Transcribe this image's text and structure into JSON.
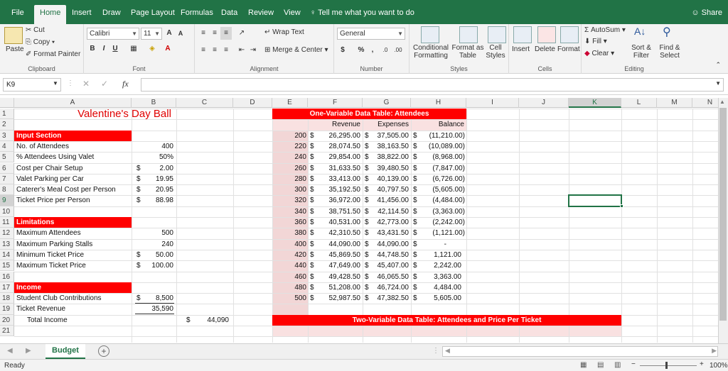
{
  "menu": {
    "tabs": [
      "File",
      "Home",
      "Insert",
      "Draw",
      "Page Layout",
      "Formulas",
      "Data",
      "Review",
      "View"
    ],
    "active": "Home",
    "tell_me": "Tell me what you want to do",
    "share": "Share"
  },
  "ribbon": {
    "clipboard": {
      "label": "Clipboard",
      "paste": "Paste",
      "cut": "Cut",
      "copy": "Copy",
      "format_painter": "Format Painter"
    },
    "font": {
      "label": "Font",
      "family": "Calibri",
      "size": "11",
      "bold": "B",
      "italic": "I",
      "underline": "U"
    },
    "alignment": {
      "label": "Alignment",
      "wrap_text": "Wrap Text",
      "merge_center": "Merge & Center"
    },
    "number": {
      "label": "Number",
      "format": "General",
      "currency": "$",
      "percent": "%",
      "comma": ","
    },
    "styles": {
      "label": "Styles",
      "conditional1": "Conditional",
      "conditional2": "Formatting",
      "format_as1": "Format as",
      "format_as2": "Table",
      "cell1": "Cell",
      "cell2": "Styles"
    },
    "cells": {
      "label": "Cells",
      "insert": "Insert",
      "delete": "Delete",
      "format": "Format"
    },
    "editing": {
      "label": "Editing",
      "autosum": "AutoSum",
      "fill": "Fill",
      "clear": "Clear",
      "sort1": "Sort &",
      "sort2": "Filter",
      "find1": "Find &",
      "find2": "Select"
    }
  },
  "formula_bar": {
    "name_box": "K9",
    "fx": "fx",
    "value": ""
  },
  "columns": [
    "A",
    "B",
    "C",
    "D",
    "E",
    "F",
    "G",
    "H",
    "I",
    "J",
    "K",
    "L",
    "M",
    "N"
  ],
  "rows": [
    "1",
    "2",
    "3",
    "4",
    "5",
    "6",
    "7",
    "8",
    "9",
    "10",
    "11",
    "12",
    "13",
    "14",
    "15",
    "16",
    "17",
    "18",
    "19",
    "20",
    "21"
  ],
  "sheet": {
    "title": "Valentine's Day Ball",
    "input_section": "Input Section",
    "inputs": [
      {
        "label": "No. of Attendees",
        "cur": "",
        "value": "400"
      },
      {
        "label": "% Attendees Using Valet",
        "cur": "",
        "value": "50%"
      },
      {
        "label": "Cost per Chair Setup",
        "cur": "$",
        "value": "2.00"
      },
      {
        "label": "Valet Parking per Car",
        "cur": "$",
        "value": "19.95"
      },
      {
        "label": "Caterer's Meal Cost per Person",
        "cur": "$",
        "value": "20.95"
      },
      {
        "label": "Ticket Price per Person",
        "cur": "$",
        "value": "88.98"
      }
    ],
    "limitations": "Limitations",
    "limits": [
      {
        "label": "Maximum Attendees",
        "cur": "",
        "value": "500"
      },
      {
        "label": "Maximum Parking Stalls",
        "cur": "",
        "value": "240"
      },
      {
        "label": "Minimum Ticket Price",
        "cur": "$",
        "value": "50.00"
      },
      {
        "label": "Maximum Ticket Price",
        "cur": "$",
        "value": "100.00"
      }
    ],
    "income": "Income",
    "income_rows": [
      {
        "label": "Student Club Contributions",
        "cur": "$",
        "value": "8,500"
      },
      {
        "label": "Ticket Revenue",
        "cur": "",
        "value": "35,590"
      }
    ],
    "total_label": "Total Income",
    "total_cur": "$",
    "total_value": "44,090"
  },
  "one_var": {
    "title": "One-Variable Data Table: Attendees",
    "headers": [
      "Revenue",
      "Expenses",
      "Balance"
    ],
    "rows": [
      [
        "200",
        "$",
        "26,295.00",
        "$",
        "37,505.00",
        "$",
        "(11,210.00)"
      ],
      [
        "220",
        "$",
        "28,074.50",
        "$",
        "38,163.50",
        "$",
        "(10,089.00)"
      ],
      [
        "240",
        "$",
        "29,854.00",
        "$",
        "38,822.00",
        "$",
        "(8,968.00)"
      ],
      [
        "260",
        "$",
        "31,633.50",
        "$",
        "39,480.50",
        "$",
        "(7,847.00)"
      ],
      [
        "280",
        "$",
        "33,413.00",
        "$",
        "40,139.00",
        "$",
        "(6,726.00)"
      ],
      [
        "300",
        "$",
        "35,192.50",
        "$",
        "40,797.50",
        "$",
        "(5,605.00)"
      ],
      [
        "320",
        "$",
        "36,972.00",
        "$",
        "41,456.00",
        "$",
        "(4,484.00)"
      ],
      [
        "340",
        "$",
        "38,751.50",
        "$",
        "42,114.50",
        "$",
        "(3,363.00)"
      ],
      [
        "360",
        "$",
        "40,531.00",
        "$",
        "42,773.00",
        "$",
        "(2,242.00)"
      ],
      [
        "380",
        "$",
        "42,310.50",
        "$",
        "43,431.50",
        "$",
        "(1,121.00)"
      ],
      [
        "400",
        "$",
        "44,090.00",
        "$",
        "44,090.00",
        "$",
        "-"
      ],
      [
        "420",
        "$",
        "45,869.50",
        "$",
        "44,748.50",
        "$",
        "1,121.00"
      ],
      [
        "440",
        "$",
        "47,649.00",
        "$",
        "45,407.00",
        "$",
        "2,242.00"
      ],
      [
        "460",
        "$",
        "49,428.50",
        "$",
        "46,065.50",
        "$",
        "3,363.00"
      ],
      [
        "480",
        "$",
        "51,208.00",
        "$",
        "46,724.00",
        "$",
        "4,484.00"
      ],
      [
        "500",
        "$",
        "52,987.50",
        "$",
        "47,382.50",
        "$",
        "5,605.00"
      ]
    ]
  },
  "two_var": {
    "title": "Two-Variable Data Table: Attendees and Price Per Ticket"
  },
  "sheet_tabs": {
    "active": "Budget",
    "add": "+"
  },
  "status": {
    "ready": "Ready",
    "zoom": "100%"
  }
}
